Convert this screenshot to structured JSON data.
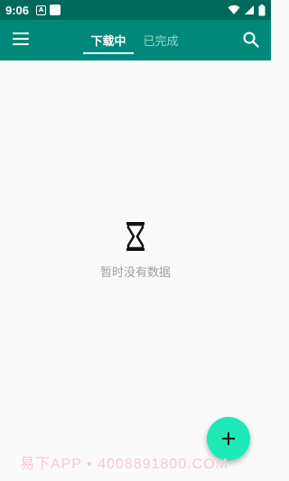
{
  "status_bar": {
    "time": "9:06",
    "notif_letter": "A",
    "icons": [
      "notification-a-icon",
      "notification-square-icon",
      "wifi-icon",
      "signal-icon",
      "battery-icon"
    ]
  },
  "app_bar": {
    "tabs": [
      {
        "label": "下载中",
        "active": true
      },
      {
        "label": "已完成",
        "active": false
      }
    ],
    "colors": {
      "status_bar": "#00695c",
      "app_bar": "#00897b",
      "fab": "#1de9b6"
    }
  },
  "empty_state": {
    "icon": "hourglass-icon",
    "message": "暂时没有数据"
  },
  "fab": {
    "icon": "plus-icon"
  },
  "watermark": "易下APP • 4008891800.COM"
}
